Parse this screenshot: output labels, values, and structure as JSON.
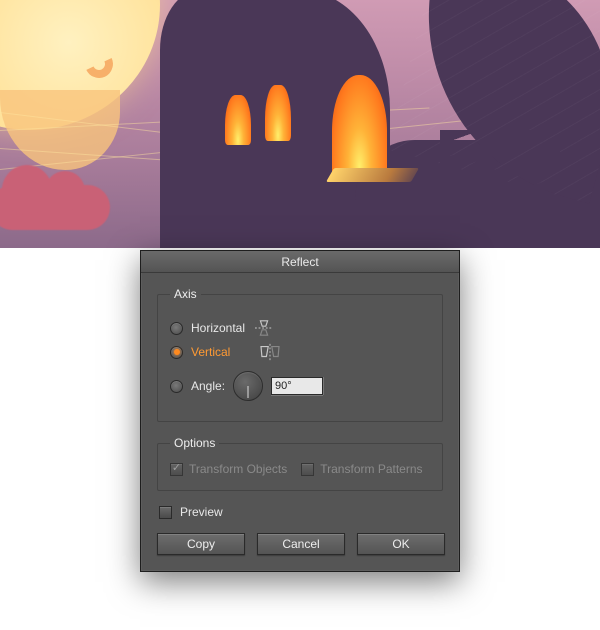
{
  "dialog": {
    "title": "Reflect",
    "axis": {
      "legend": "Axis",
      "horizontal_label": "Horizontal",
      "vertical_label": "Vertical",
      "angle_label": "Angle:",
      "angle_value": "90°",
      "selected": "vertical"
    },
    "options": {
      "legend": "Options",
      "transform_objects_label": "Transform Objects",
      "transform_objects_checked": true,
      "transform_patterns_label": "Transform Patterns",
      "transform_patterns_checked": false,
      "enabled": false
    },
    "preview": {
      "label": "Preview",
      "checked": false
    },
    "buttons": {
      "copy": "Copy",
      "cancel": "Cancel",
      "ok": "OK"
    }
  }
}
